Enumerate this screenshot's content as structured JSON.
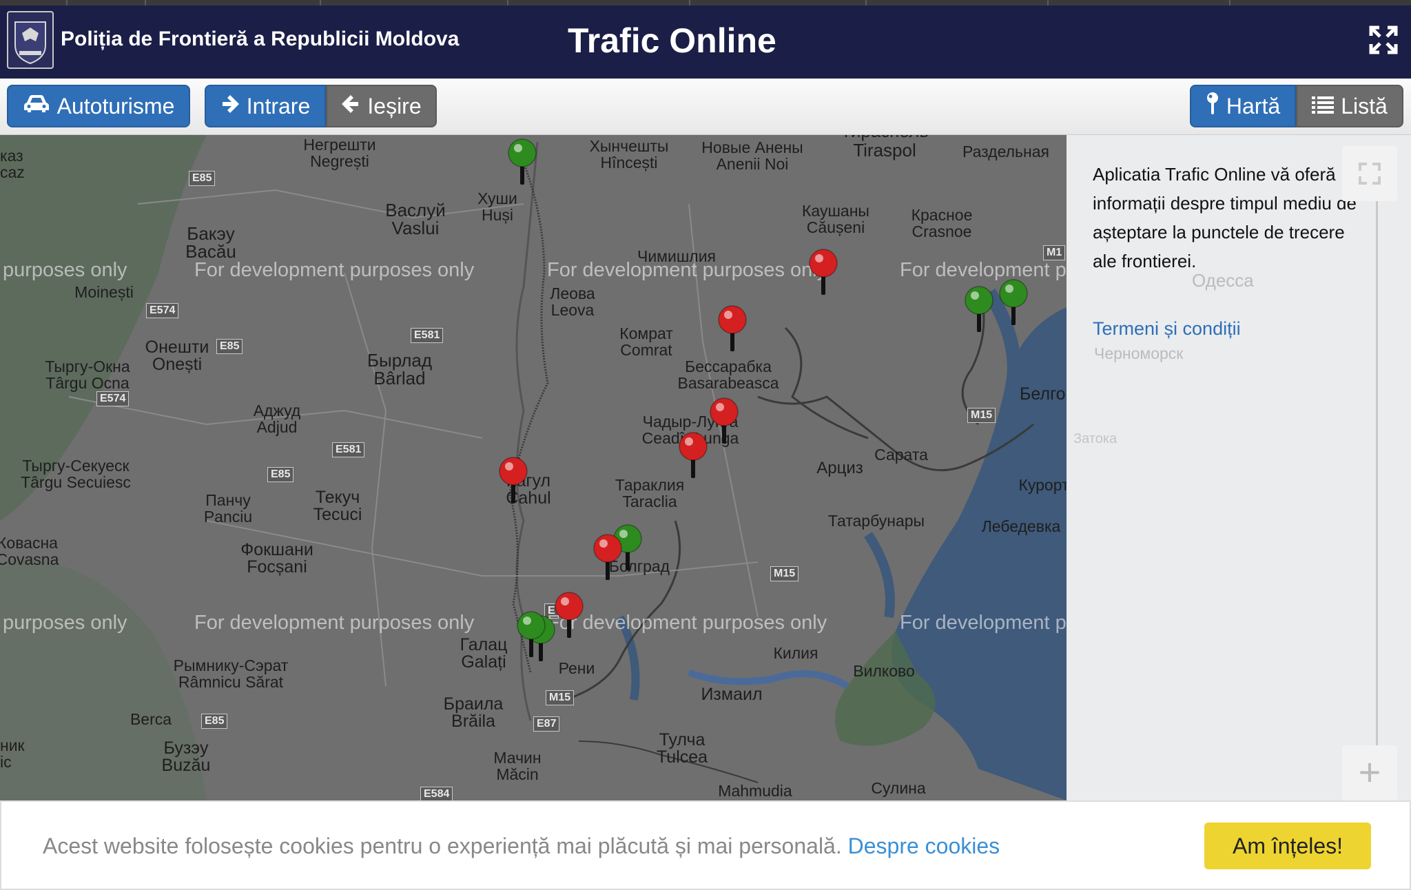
{
  "header": {
    "org_name": "Poliția de Frontieră a Republicii Moldova",
    "app_title": "Trafic Online",
    "logo_icon": "border-police-crest-icon",
    "fullscreen_icon": "expand-arrows-icon"
  },
  "toolbar": {
    "vehicle_label": "Autoturisme",
    "vehicle_icon": "car-icon",
    "entry_label": "Intrare",
    "entry_icon": "arrow-right-icon",
    "exit_label": "Ieșire",
    "exit_icon": "arrow-left-icon",
    "map_label": "Hartă",
    "map_icon": "map-pin-icon",
    "list_label": "Listă",
    "list_icon": "list-icon"
  },
  "map": {
    "watermark": "For development purposes only",
    "watermark_clip": "purposes only",
    "labels": [
      {
        "id": "negresti",
        "text": "Негрешти\nNegrești"
      },
      {
        "id": "hincesti",
        "text": "Хынчешты\nHîncești"
      },
      {
        "id": "anenii",
        "text": "Новые Анены\nAnenii Noi"
      },
      {
        "id": "tiraspol",
        "text": "Тирасполь\nTiraspol"
      },
      {
        "id": "razdelnaya",
        "text": "Раздельная"
      },
      {
        "id": "bacau",
        "text": "Бакэу\nBacău"
      },
      {
        "id": "vaslui",
        "text": "Васлуй\nVaslui"
      },
      {
        "id": "husi",
        "text": "Хуши\nHuși"
      },
      {
        "id": "causeni",
        "text": "Каушаны\nCăușeni"
      },
      {
        "id": "crasnoe",
        "text": "Красное\nCrasnoe"
      },
      {
        "id": "cimislia",
        "text": "Чимишлия"
      },
      {
        "id": "moinesti",
        "text": "Moinești"
      },
      {
        "id": "leova",
        "text": "Леова\nLeova"
      },
      {
        "id": "comrat",
        "text": "Комрат\nComrat"
      },
      {
        "id": "onesti",
        "text": "Онешти\nOnești"
      },
      {
        "id": "tirgu_ocna",
        "text": "Тыргу-Окна\nTârgu Ocna"
      },
      {
        "id": "barlad",
        "text": "Бырлад\nBârlad"
      },
      {
        "id": "basarabeasca",
        "text": "Бессарабка\nBasarabeasca"
      },
      {
        "id": "belgorod",
        "text": "Белгород-Д"
      },
      {
        "id": "adjud",
        "text": "Аджуд\nAdjud"
      },
      {
        "id": "ceadir",
        "text": "Чадыр-Лунга\nCeadîr-Lunga"
      },
      {
        "id": "sarata",
        "text": "Сарата"
      },
      {
        "id": "secuiesc",
        "text": "Тыргу-Секуеск\nTârgu Secuiesc"
      },
      {
        "id": "cahul",
        "text": "Кагул\nCahul"
      },
      {
        "id": "taraclia",
        "text": "Тараклия\nTaraclia"
      },
      {
        "id": "artsyz",
        "text": "Арциз"
      },
      {
        "id": "kurortne",
        "text": "Курорт"
      },
      {
        "id": "panciu",
        "text": "Панчу\nPanciu"
      },
      {
        "id": "tecuci",
        "text": "Текуч\nTecuci"
      },
      {
        "id": "tatarbunary",
        "text": "Татарбунары"
      },
      {
        "id": "lebedevka",
        "text": "Лебедевка"
      },
      {
        "id": "covasna",
        "text": "Ковасна\nCovasna"
      },
      {
        "id": "focsani",
        "text": "Фокшани\nFocșani"
      },
      {
        "id": "bolgrad",
        "text": "Болград"
      },
      {
        "id": "galati",
        "text": "Галац\nGalați"
      },
      {
        "id": "kiliya",
        "text": "Килия"
      },
      {
        "id": "ramnicu",
        "text": "Рымнику-Сэрат\nRâmnicu Sărat"
      },
      {
        "id": "reni",
        "text": "Рени"
      },
      {
        "id": "vilkovo",
        "text": "Вилково"
      },
      {
        "id": "izmail",
        "text": "Измаил"
      },
      {
        "id": "braila",
        "text": "Браила\nBrăila"
      },
      {
        "id": "berca",
        "text": "Berca"
      },
      {
        "id": "buzau",
        "text": "Бузэу\nBuzău"
      },
      {
        "id": "tulcea",
        "text": "Тулча\nTulcea"
      },
      {
        "id": "macin",
        "text": "Мачин\nMăcin"
      },
      {
        "id": "mahmudia",
        "text": "Mahmudia"
      },
      {
        "id": "sulina",
        "text": "Сулина"
      },
      {
        "id": "kaz",
        "text": "каз\ncaz"
      },
      {
        "id": "nik",
        "text": "ник\nic"
      }
    ],
    "roads": [
      {
        "id": "e85a",
        "text": "E85"
      },
      {
        "id": "e574a",
        "text": "E574"
      },
      {
        "id": "e85b",
        "text": "E85"
      },
      {
        "id": "e574b",
        "text": "E574"
      },
      {
        "id": "e581a",
        "text": "E581"
      },
      {
        "id": "e581b",
        "text": "E581"
      },
      {
        "id": "e85c",
        "text": "E85"
      },
      {
        "id": "m15a",
        "text": "M15"
      },
      {
        "id": "m15b",
        "text": "M15"
      },
      {
        "id": "m15c",
        "text": "M15"
      },
      {
        "id": "e87",
        "text": "E87"
      },
      {
        "id": "e85d",
        "text": "E85"
      },
      {
        "id": "e584",
        "text": "E584"
      },
      {
        "id": "m1x",
        "text": "M1"
      },
      {
        "id": "e5x",
        "text": "E"
      }
    ],
    "markers": [
      {
        "status": "green",
        "color": "#2e8b1f"
      },
      {
        "status": "red",
        "color": "#d42020"
      },
      {
        "status": "green",
        "color": "#2e8b1f"
      },
      {
        "status": "green",
        "color": "#2e8b1f"
      },
      {
        "status": "red",
        "color": "#d42020"
      },
      {
        "status": "red",
        "color": "#d42020"
      },
      {
        "status": "red",
        "color": "#d42020"
      },
      {
        "status": "red",
        "color": "#d42020"
      },
      {
        "status": "green",
        "color": "#2e8b1f"
      },
      {
        "status": "red",
        "color": "#d42020"
      },
      {
        "status": "red",
        "color": "#d42020"
      },
      {
        "status": "green",
        "color": "#2e8b1f"
      },
      {
        "status": "green",
        "color": "#2e8b1f"
      }
    ]
  },
  "side_panel": {
    "description": "Aplicatia Trafic Online vă oferă informații despre timpul mediu de așteptare la punctele de trecere ale frontierei.",
    "terms_link": "Termeni și condiții",
    "ghost_labels": [
      "Одесса",
      "Черноморск",
      "Затока"
    ],
    "zoom_in_symbol": "+"
  },
  "cookie_banner": {
    "text": "Acest website folosește cookies pentru o experiență mai plăcută și mai personală.",
    "link": "Despre cookies",
    "accept_button": "Am înțeles!"
  },
  "colors": {
    "header_bg": "#1b1e46",
    "button_blue": "#2f6fb7",
    "button_gray": "#6c6c6c",
    "marker_red": "#d42020",
    "marker_green": "#2e8b1f",
    "cookie_button": "#eed431",
    "link_blue": "#3a8fd6"
  }
}
